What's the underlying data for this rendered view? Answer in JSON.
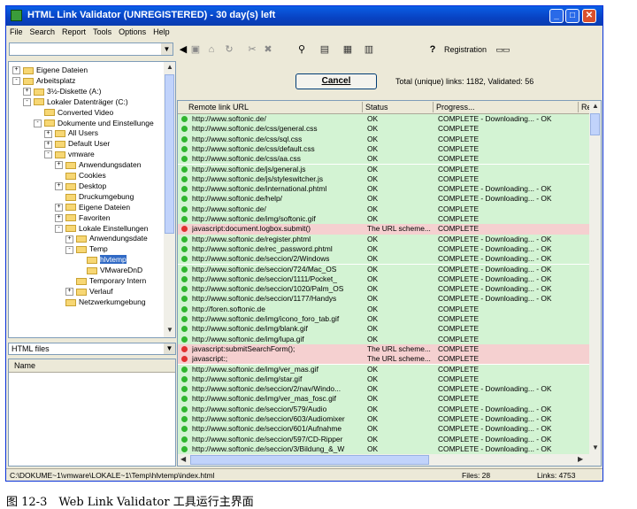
{
  "window": {
    "title": "HTML Link Validator (UNREGISTERED) - 30 day(s) left"
  },
  "menu": [
    "File",
    "Search",
    "Report",
    "Tools",
    "Options",
    "Help"
  ],
  "toolbar": {
    "registration": "Registration"
  },
  "tree": [
    {
      "label": "Eigene Dateien",
      "level": 0,
      "exp": "+"
    },
    {
      "label": "Arbeitsplatz",
      "level": 0,
      "exp": "-"
    },
    {
      "label": "3½-Diskette (A:)",
      "level": 1,
      "exp": "+"
    },
    {
      "label": "Lokaler Datenträger (C:)",
      "level": 1,
      "exp": "-"
    },
    {
      "label": "Converted Video",
      "level": 2,
      "exp": ""
    },
    {
      "label": "Dokumente und Einstellunge",
      "level": 2,
      "exp": "-"
    },
    {
      "label": "All Users",
      "level": 3,
      "exp": "+"
    },
    {
      "label": "Default User",
      "level": 3,
      "exp": "+"
    },
    {
      "label": "vmware",
      "level": 3,
      "exp": "-"
    },
    {
      "label": "Anwendungsdaten",
      "level": 4,
      "exp": "+"
    },
    {
      "label": "Cookies",
      "level": 4,
      "exp": ""
    },
    {
      "label": "Desktop",
      "level": 4,
      "exp": "+"
    },
    {
      "label": "Druckumgebung",
      "level": 4,
      "exp": ""
    },
    {
      "label": "Eigene Dateien",
      "level": 4,
      "exp": "+"
    },
    {
      "label": "Favoriten",
      "level": 4,
      "exp": "+"
    },
    {
      "label": "Lokale Einstellungen",
      "level": 4,
      "exp": "-"
    },
    {
      "label": "Anwendungsdate",
      "level": 5,
      "exp": "+"
    },
    {
      "label": "Temp",
      "level": 5,
      "exp": "-"
    },
    {
      "label": "hlvtemp",
      "level": 6,
      "exp": ""
    },
    {
      "label": "VMwareDnD",
      "level": 6,
      "exp": ""
    },
    {
      "label": "Temporary Intern",
      "level": 5,
      "exp": ""
    },
    {
      "label": "Verlauf",
      "level": 5,
      "exp": "+"
    },
    {
      "label": "Netzwerkumgebung",
      "level": 4,
      "exp": ""
    }
  ],
  "filter": {
    "selected": "HTML files"
  },
  "files_panel": {
    "column": "Name"
  },
  "cancel_label": "Cancel",
  "stats": {
    "text": "Total (unique) links: 1182,   Validated: 56"
  },
  "grid": {
    "columns": [
      "Remote link URL",
      "Status",
      "Progress...",
      "Re"
    ],
    "rows": [
      {
        "url": "http://www.softonic.de/",
        "status": "OK",
        "progress": "COMPLETE - Downloading... - OK",
        "state": "ok"
      },
      {
        "url": "http://www.softonic.de/css/general.css",
        "status": "OK",
        "progress": "COMPLETE",
        "state": "ok"
      },
      {
        "url": "http://www.softonic.de/css/sql.css",
        "status": "OK",
        "progress": "COMPLETE",
        "state": "ok"
      },
      {
        "url": "http://www.softonic.de/css/default.css",
        "status": "OK",
        "progress": "COMPLETE",
        "state": "ok"
      },
      {
        "url": "http://www.softonic.de/css/aa.css",
        "status": "OK",
        "progress": "COMPLETE",
        "state": "ok"
      },
      {
        "url": "http://www.softonic.de/js/general.js",
        "status": "OK",
        "progress": "COMPLETE",
        "state": "ok"
      },
      {
        "url": "http://www.softonic.de/js/styleswitcher.js",
        "status": "OK",
        "progress": "COMPLETE",
        "state": "ok"
      },
      {
        "url": "http://www.softonic.de/international.phtml",
        "status": "OK",
        "progress": "COMPLETE - Downloading... - OK",
        "state": "ok"
      },
      {
        "url": "http://www.softonic.de/help/",
        "status": "OK",
        "progress": "COMPLETE - Downloading... - OK",
        "state": "ok"
      },
      {
        "url": "http://www.softonic.de/",
        "status": "OK",
        "progress": "COMPLETE",
        "state": "ok"
      },
      {
        "url": "http://www.softonic.de/img/softonic.gif",
        "status": "OK",
        "progress": "COMPLETE",
        "state": "ok"
      },
      {
        "url": "javascript:document.logbox.submit()",
        "status": "The URL scheme...",
        "progress": "COMPLETE",
        "state": "err"
      },
      {
        "url": "http://www.softonic.de/register.phtml",
        "status": "OK",
        "progress": "COMPLETE - Downloading... - OK",
        "state": "ok"
      },
      {
        "url": "http://www.softonic.de/rec_password.phtml",
        "status": "OK",
        "progress": "COMPLETE - Downloading... - OK",
        "state": "ok"
      },
      {
        "url": "http://www.softonic.de/seccion/2/Windows",
        "status": "OK",
        "progress": "COMPLETE - Downloading... - OK",
        "state": "ok"
      },
      {
        "url": "http://www.softonic.de/seccion/724/Mac_OS",
        "status": "OK",
        "progress": "COMPLETE - Downloading... - OK",
        "state": "ok"
      },
      {
        "url": "http://www.softonic.de/seccion/1111/Pocket_",
        "status": "OK",
        "progress": "COMPLETE - Downloading... - OK",
        "state": "ok"
      },
      {
        "url": "http://www.softonic.de/seccion/1020/Palm_OS",
        "status": "OK",
        "progress": "COMPLETE - Downloading... - OK",
        "state": "ok"
      },
      {
        "url": "http://www.softonic.de/seccion/1177/Handys",
        "status": "OK",
        "progress": "COMPLETE - Downloading... - OK",
        "state": "ok"
      },
      {
        "url": "http://foren.softonic.de",
        "status": "OK",
        "progress": "COMPLETE",
        "state": "ok"
      },
      {
        "url": "http://www.softonic.de/img/icono_foro_tab.gif",
        "status": "OK",
        "progress": "COMPLETE",
        "state": "ok"
      },
      {
        "url": "http://www.softonic.de/img/blank.gif",
        "status": "OK",
        "progress": "COMPLETE",
        "state": "ok"
      },
      {
        "url": "http://www.softonic.de/img/lupa.gif",
        "status": "OK",
        "progress": "COMPLETE",
        "state": "ok"
      },
      {
        "url": "javascript:submitSearchForm();",
        "status": "The URL scheme...",
        "progress": "COMPLETE",
        "state": "err"
      },
      {
        "url": "javascript:;",
        "status": "The URL scheme...",
        "progress": "COMPLETE",
        "state": "err"
      },
      {
        "url": "http://www.softonic.de/img/ver_mas.gif",
        "status": "OK",
        "progress": "COMPLETE",
        "state": "ok"
      },
      {
        "url": "http://www.softonic.de/img/star.gif",
        "status": "OK",
        "progress": "COMPLETE",
        "state": "ok"
      },
      {
        "url": "http://www.softonic.de/seccion/2/nav/Windo...",
        "status": "OK",
        "progress": "COMPLETE - Downloading... - OK",
        "state": "ok"
      },
      {
        "url": "http://www.softonic.de/img/ver_mas_fosc.gif",
        "status": "OK",
        "progress": "COMPLETE",
        "state": "ok"
      },
      {
        "url": "http://www.softonic.de/seccion/579/Audio",
        "status": "OK",
        "progress": "COMPLETE - Downloading... - OK",
        "state": "ok"
      },
      {
        "url": "http://www.softonic.de/seccion/603/Audiomixer",
        "status": "OK",
        "progress": "COMPLETE - Downloading... - OK",
        "state": "ok"
      },
      {
        "url": "http://www.softonic.de/seccion/601/Aufnahme",
        "status": "OK",
        "progress": "COMPLETE - Downloading... - OK",
        "state": "ok"
      },
      {
        "url": "http://www.softonic.de/seccion/597/CD-Ripper",
        "status": "OK",
        "progress": "COMPLETE - Downloading... - OK",
        "state": "ok"
      },
      {
        "url": "http://www.softonic.de/seccion/3/Bildung_&_W",
        "status": "OK",
        "progress": "COMPLETE - Downloading... - OK",
        "state": "ok"
      }
    ]
  },
  "statusbar": {
    "path": "C:\\DOKUME~1\\vmware\\LOKALE~1\\Temp\\hlvtemp\\index.html",
    "files": "Files: 28",
    "links": "Links: 4753"
  },
  "caption": "图 12-3　Web Link Validator 工具运行主界面",
  "colors": {
    "ok_row": "#d3f3d3",
    "error_row": "#f5d0d0",
    "titlebar": "#0842c2"
  },
  "icons": [
    "app-icon",
    "minimize-icon",
    "maximize-icon",
    "close-icon",
    "back-icon",
    "binoculars-icon",
    "help-icon",
    "folder-icon",
    "status-ok-icon",
    "status-error-icon"
  ]
}
